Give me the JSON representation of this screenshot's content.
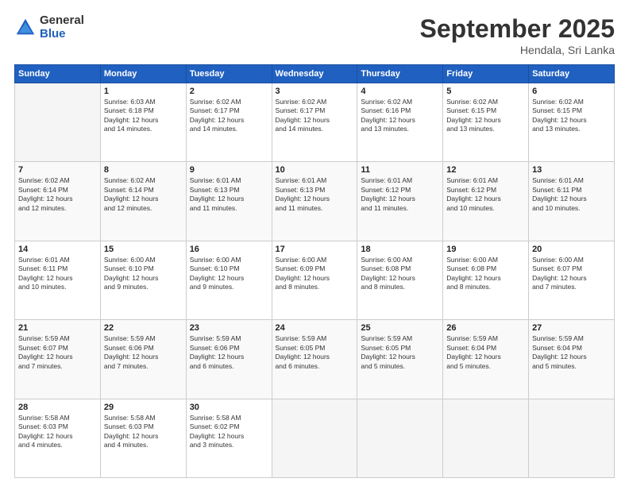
{
  "logo": {
    "general": "General",
    "blue": "Blue"
  },
  "title": "September 2025",
  "subtitle": "Hendala, Sri Lanka",
  "days_header": [
    "Sunday",
    "Monday",
    "Tuesday",
    "Wednesday",
    "Thursday",
    "Friday",
    "Saturday"
  ],
  "weeks": [
    [
      {
        "day": "",
        "detail": ""
      },
      {
        "day": "1",
        "detail": "Sunrise: 6:03 AM\nSunset: 6:18 PM\nDaylight: 12 hours\nand 14 minutes."
      },
      {
        "day": "2",
        "detail": "Sunrise: 6:02 AM\nSunset: 6:17 PM\nDaylight: 12 hours\nand 14 minutes."
      },
      {
        "day": "3",
        "detail": "Sunrise: 6:02 AM\nSunset: 6:17 PM\nDaylight: 12 hours\nand 14 minutes."
      },
      {
        "day": "4",
        "detail": "Sunrise: 6:02 AM\nSunset: 6:16 PM\nDaylight: 12 hours\nand 13 minutes."
      },
      {
        "day": "5",
        "detail": "Sunrise: 6:02 AM\nSunset: 6:15 PM\nDaylight: 12 hours\nand 13 minutes."
      },
      {
        "day": "6",
        "detail": "Sunrise: 6:02 AM\nSunset: 6:15 PM\nDaylight: 12 hours\nand 13 minutes."
      }
    ],
    [
      {
        "day": "7",
        "detail": "Sunrise: 6:02 AM\nSunset: 6:14 PM\nDaylight: 12 hours\nand 12 minutes."
      },
      {
        "day": "8",
        "detail": "Sunrise: 6:02 AM\nSunset: 6:14 PM\nDaylight: 12 hours\nand 12 minutes."
      },
      {
        "day": "9",
        "detail": "Sunrise: 6:01 AM\nSunset: 6:13 PM\nDaylight: 12 hours\nand 11 minutes."
      },
      {
        "day": "10",
        "detail": "Sunrise: 6:01 AM\nSunset: 6:13 PM\nDaylight: 12 hours\nand 11 minutes."
      },
      {
        "day": "11",
        "detail": "Sunrise: 6:01 AM\nSunset: 6:12 PM\nDaylight: 12 hours\nand 11 minutes."
      },
      {
        "day": "12",
        "detail": "Sunrise: 6:01 AM\nSunset: 6:12 PM\nDaylight: 12 hours\nand 10 minutes."
      },
      {
        "day": "13",
        "detail": "Sunrise: 6:01 AM\nSunset: 6:11 PM\nDaylight: 12 hours\nand 10 minutes."
      }
    ],
    [
      {
        "day": "14",
        "detail": "Sunrise: 6:01 AM\nSunset: 6:11 PM\nDaylight: 12 hours\nand 10 minutes."
      },
      {
        "day": "15",
        "detail": "Sunrise: 6:00 AM\nSunset: 6:10 PM\nDaylight: 12 hours\nand 9 minutes."
      },
      {
        "day": "16",
        "detail": "Sunrise: 6:00 AM\nSunset: 6:10 PM\nDaylight: 12 hours\nand 9 minutes."
      },
      {
        "day": "17",
        "detail": "Sunrise: 6:00 AM\nSunset: 6:09 PM\nDaylight: 12 hours\nand 8 minutes."
      },
      {
        "day": "18",
        "detail": "Sunrise: 6:00 AM\nSunset: 6:08 PM\nDaylight: 12 hours\nand 8 minutes."
      },
      {
        "day": "19",
        "detail": "Sunrise: 6:00 AM\nSunset: 6:08 PM\nDaylight: 12 hours\nand 8 minutes."
      },
      {
        "day": "20",
        "detail": "Sunrise: 6:00 AM\nSunset: 6:07 PM\nDaylight: 12 hours\nand 7 minutes."
      }
    ],
    [
      {
        "day": "21",
        "detail": "Sunrise: 5:59 AM\nSunset: 6:07 PM\nDaylight: 12 hours\nand 7 minutes."
      },
      {
        "day": "22",
        "detail": "Sunrise: 5:59 AM\nSunset: 6:06 PM\nDaylight: 12 hours\nand 7 minutes."
      },
      {
        "day": "23",
        "detail": "Sunrise: 5:59 AM\nSunset: 6:06 PM\nDaylight: 12 hours\nand 6 minutes."
      },
      {
        "day": "24",
        "detail": "Sunrise: 5:59 AM\nSunset: 6:05 PM\nDaylight: 12 hours\nand 6 minutes."
      },
      {
        "day": "25",
        "detail": "Sunrise: 5:59 AM\nSunset: 6:05 PM\nDaylight: 12 hours\nand 5 minutes."
      },
      {
        "day": "26",
        "detail": "Sunrise: 5:59 AM\nSunset: 6:04 PM\nDaylight: 12 hours\nand 5 minutes."
      },
      {
        "day": "27",
        "detail": "Sunrise: 5:59 AM\nSunset: 6:04 PM\nDaylight: 12 hours\nand 5 minutes."
      }
    ],
    [
      {
        "day": "28",
        "detail": "Sunrise: 5:58 AM\nSunset: 6:03 PM\nDaylight: 12 hours\nand 4 minutes."
      },
      {
        "day": "29",
        "detail": "Sunrise: 5:58 AM\nSunset: 6:03 PM\nDaylight: 12 hours\nand 4 minutes."
      },
      {
        "day": "30",
        "detail": "Sunrise: 5:58 AM\nSunset: 6:02 PM\nDaylight: 12 hours\nand 3 minutes."
      },
      {
        "day": "",
        "detail": ""
      },
      {
        "day": "",
        "detail": ""
      },
      {
        "day": "",
        "detail": ""
      },
      {
        "day": "",
        "detail": ""
      }
    ]
  ]
}
